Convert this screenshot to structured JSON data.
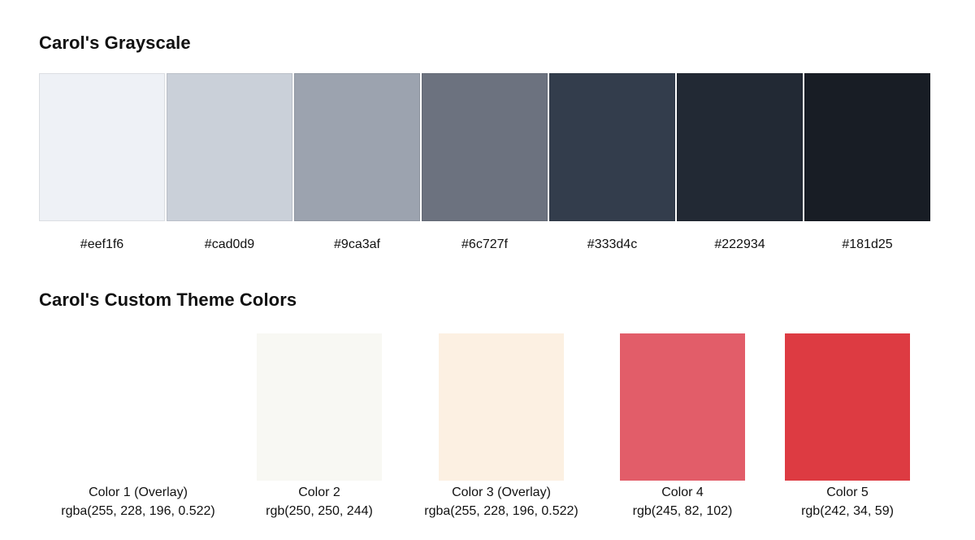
{
  "grayscale": {
    "title": "Carol's Grayscale",
    "swatches": [
      {
        "hex": "#eef1f6",
        "color": "#eef1f6"
      },
      {
        "hex": "#cad0d9",
        "color": "#cad0d9"
      },
      {
        "hex": "#9ca3af",
        "color": "#9ca3af"
      },
      {
        "hex": "#6c727f",
        "color": "#6c727f"
      },
      {
        "hex": "#333d4c",
        "color": "#333d4c"
      },
      {
        "hex": "#222934",
        "color": "#222934"
      },
      {
        "hex": "#181d25",
        "color": "#181d25"
      }
    ]
  },
  "theme": {
    "title": "Carol's Custom Theme Colors",
    "colors": [
      {
        "name": "Color 1 (Overlay)",
        "value": "rgba(255, 228, 196, 0.522)",
        "swatch": "#ffffff"
      },
      {
        "name": "Color 2",
        "value": "rgb(250, 250, 244)",
        "swatch": "#f8f8f3"
      },
      {
        "name": "Color 3 (Overlay)",
        "value": "rgba(255, 228, 196, 0.522)",
        "swatch": "#fcf0e2"
      },
      {
        "name": "Color 4",
        "value": "rgb(245, 82, 102)",
        "swatch": "#e25d69"
      },
      {
        "name": "Color 5",
        "value": "rgb(242, 34, 59)",
        "swatch": "#dd3b42"
      }
    ]
  }
}
